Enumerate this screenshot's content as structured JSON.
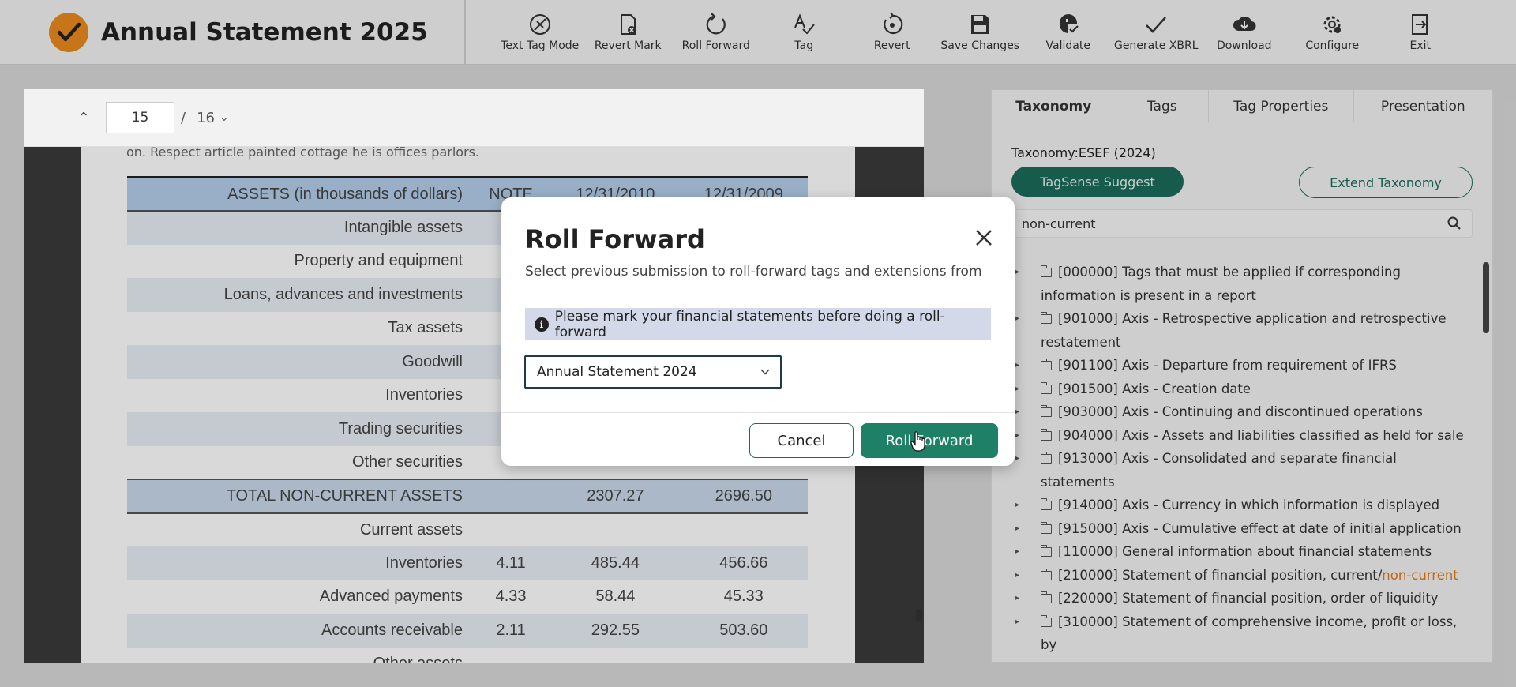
{
  "app": {
    "title": "Annual Statement 2025",
    "brand_color": "#e98b1e",
    "accent": "#1e8066"
  },
  "toolbar": [
    {
      "label": "Text Tag Mode",
      "icon": "text-tag-mode-icon"
    },
    {
      "label": "Revert Mark",
      "icon": "revert-mark-icon"
    },
    {
      "label": "Roll Forward",
      "icon": "roll-forward-icon"
    },
    {
      "label": "Tag",
      "icon": "tag-icon"
    },
    {
      "label": "Revert",
      "icon": "revert-icon"
    },
    {
      "label": "Save Changes",
      "icon": "save-icon"
    },
    {
      "label": "Validate",
      "icon": "validate-icon"
    },
    {
      "label": "Generate XBRL",
      "icon": "generate-xbrl-icon"
    },
    {
      "label": "Download",
      "icon": "download-icon"
    },
    {
      "label": "Configure",
      "icon": "configure-icon"
    },
    {
      "label": "Exit",
      "icon": "exit-icon"
    }
  ],
  "pager": {
    "current_page": "15",
    "separator": "/",
    "total_pages": "16"
  },
  "document": {
    "note_text": "on. Respect article painted cottage he is offices parlors.",
    "table": {
      "headers": [
        "ASSETS (in thousands of dollars)",
        "NOTE",
        "12/31/2010",
        "12/31/2009"
      ],
      "rows": [
        [
          "Intangible assets",
          "",
          "",
          ""
        ],
        [
          "Property and equipment",
          "",
          "",
          ""
        ],
        [
          "Loans, advances and investments",
          "",
          "",
          ""
        ],
        [
          "Tax assets",
          "",
          "",
          ""
        ],
        [
          "Goodwill",
          "",
          "",
          ""
        ],
        [
          "Inventories",
          "",
          "",
          ""
        ],
        [
          "Trading securities",
          "",
          "",
          ""
        ],
        [
          "Other securities",
          "",
          "",
          ""
        ],
        [
          "TOTAL NON-CURRENT ASSETS",
          "",
          "2307.27",
          "2696.50"
        ],
        [
          "Current assets",
          "",
          "",
          ""
        ],
        [
          "Inventories",
          "4.11",
          "485.44",
          "456.66"
        ],
        [
          "Advanced payments",
          "4.33",
          "58.44",
          "45.33"
        ],
        [
          "Accounts receivable",
          "2.11",
          "292.55",
          "503.60"
        ],
        [
          "Other assets",
          "",
          "",
          ""
        ]
      ]
    }
  },
  "panel": {
    "tabs": [
      "Taxonomy",
      "Tags",
      "Tag Properties",
      "Presentation"
    ],
    "active_tab": "Taxonomy",
    "taxonomy_label": "Taxonomy:ESEF (2024)",
    "suggest_button": "TagSense Suggest",
    "extend_button": "Extend Taxonomy",
    "search_value": "non-current",
    "tree": [
      {
        "text": "[000000] Tags that must be applied if corresponding information is present in a report"
      },
      {
        "text": "[901000] Axis - Retrospective application and retrospective restatement"
      },
      {
        "text": "[901100] Axis - Departure from requirement of IFRS"
      },
      {
        "text": "[901500] Axis - Creation date"
      },
      {
        "text": "[903000] Axis - Continuing and discontinued operations"
      },
      {
        "text": "[904000] Axis - Assets and liabilities classified as held for sale"
      },
      {
        "text": "[913000] Axis - Consolidated and separate financial statements"
      },
      {
        "text": "[914000] Axis - Currency in which information is displayed"
      },
      {
        "text": "[915000] Axis - Cumulative effect at date of initial application"
      },
      {
        "text": "[110000] General information about financial statements"
      },
      {
        "text": "[210000] Statement of financial position, current/",
        "highlight": "non-current"
      },
      {
        "text": "[220000] Statement of financial position, order of liquidity"
      },
      {
        "text": "[310000] Statement of comprehensive income, profit or loss, by"
      }
    ]
  },
  "modal": {
    "title": "Roll Forward",
    "subtitle": "Select previous submission to roll-forward tags and extensions from",
    "info": "Please mark your financial statements before doing a roll-forward",
    "selected_submission": "Annual Statement 2024",
    "cancel_label": "Cancel",
    "confirm_label": "Roll Forward"
  }
}
